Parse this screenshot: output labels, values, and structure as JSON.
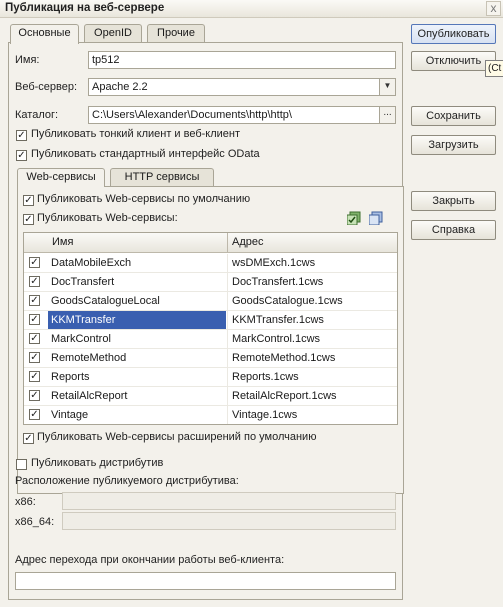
{
  "window": {
    "title": "Публикация на веб-сервере",
    "close": "x"
  },
  "tabs": [
    "Основные",
    "OpenID",
    "Прочие"
  ],
  "form": {
    "name_label": "Имя:",
    "name_value": "tp512",
    "webserver_label": "Веб-сервер:",
    "webserver_value": "Apache 2.2",
    "catalog_label": "Каталог:",
    "catalog_value": "C:\\Users\\Alexander\\Documents\\http\\http\\",
    "catalog_button": "...",
    "publish_thin_client": {
      "label": "Публиковать тонкий клиент и веб-клиент",
      "checked": true
    },
    "publish_odata": {
      "label": "Публиковать стандартный интерфейс OData",
      "checked": true
    }
  },
  "subtabs": [
    "Web-сервисы",
    "HTTP сервисы"
  ],
  "services": {
    "publish_default": {
      "label": "Публиковать Web-сервисы по умолчанию",
      "checked": true
    },
    "publish_ws": {
      "label": "Публиковать Web-сервисы:",
      "checked": true
    },
    "columns": [
      "Имя",
      "Адрес"
    ],
    "rows": [
      {
        "name": "DataMobileExch",
        "address": "wsDMExch.1cws",
        "checked": true,
        "selected": false
      },
      {
        "name": "DocTransfert",
        "address": "DocTransfert.1cws",
        "checked": true,
        "selected": false
      },
      {
        "name": "GoodsCatalogueLocal",
        "address": "GoodsCatalogue.1cws",
        "checked": true,
        "selected": false
      },
      {
        "name": "KKMTransfer",
        "address": "KKMTransfer.1cws",
        "checked": true,
        "selected": true
      },
      {
        "name": "MarkControl",
        "address": "MarkControl.1cws",
        "checked": true,
        "selected": false
      },
      {
        "name": "RemoteMethod",
        "address": "RemoteMethod.1cws",
        "checked": true,
        "selected": false
      },
      {
        "name": "Reports",
        "address": "Reports.1cws",
        "checked": true,
        "selected": false
      },
      {
        "name": "RetailAlcReport",
        "address": "RetailAlcReport.1cws",
        "checked": true,
        "selected": false
      },
      {
        "name": "Vintage",
        "address": "Vintage.1cws",
        "checked": true,
        "selected": false
      }
    ],
    "publish_extensions": {
      "label": "Публиковать Web-сервисы расширений по умолчанию",
      "checked": true
    }
  },
  "distrib": {
    "publish": {
      "label": "Публиковать дистрибутив",
      "checked": false
    },
    "location_label": "Расположение публикуемого дистрибутива:",
    "x86_label": "x86:",
    "x86_64_label": "x86_64:",
    "x86_value": "",
    "x86_64_value": ""
  },
  "redirect": {
    "label": "Адрес перехода при окончании работы веб-клиента:",
    "value": ""
  },
  "buttons": {
    "publish": "Опубликовать",
    "unpublish": "Отключить",
    "save": "Сохранить",
    "load": "Загрузить",
    "close": "Закрыть",
    "help": "Справка"
  },
  "tooltip": "(Ct"
}
